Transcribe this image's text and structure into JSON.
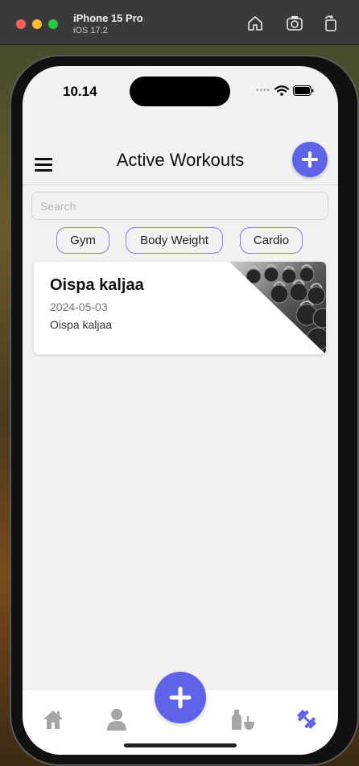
{
  "simulator": {
    "title": "iPhone 15 Pro",
    "subtitle": "iOS 17.2",
    "buttons": [
      "home-icon",
      "screenshot-icon",
      "rotate-icon"
    ]
  },
  "status_bar": {
    "time": "10.14",
    "icons": [
      "wifi-icon",
      "battery-icon"
    ]
  },
  "header": {
    "title": "Active Workouts",
    "menu_icon": "hamburger-menu-icon",
    "add_icon": "plus-icon"
  },
  "search": {
    "placeholder": "Search",
    "value": ""
  },
  "filters": [
    "Gym",
    "Body Weight",
    "Cardio"
  ],
  "workouts": [
    {
      "title": "Oispa kaljaa",
      "date": "2024-05-03",
      "description": "Oispa kaljaa",
      "image": "kettlebells-photo"
    }
  ],
  "tab_bar": {
    "items": [
      "home-icon",
      "profile-icon",
      "add-workout-icon",
      "nutrition-icon",
      "workouts-icon"
    ],
    "active": "workouts-icon"
  },
  "colors": {
    "accent": "#5f63e8",
    "chip_border": "#7b7ff0",
    "tab_inactive": "#a6a6a6",
    "screen_bg": "#f2f2f2"
  }
}
